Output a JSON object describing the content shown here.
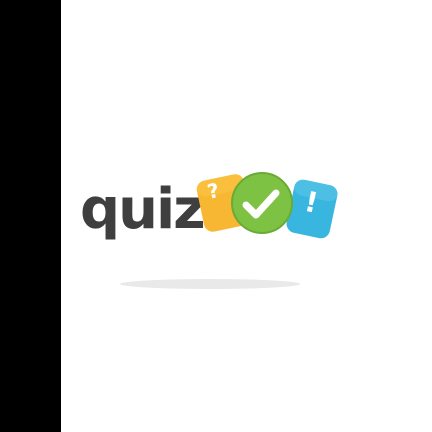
{
  "logo": {
    "word": "quiz",
    "badges": [
      {
        "symbol": "?",
        "shape": "rounded-square",
        "color": "#f7b733"
      },
      {
        "symbol": "✓",
        "shape": "circle",
        "color": "#7dc242"
      },
      {
        "symbol": "!",
        "shape": "rounded-square",
        "color": "#39b6e0"
      }
    ],
    "text_color": "#3f3f3f",
    "shadow_color": "#e6e6e6"
  },
  "side_panel": {
    "color": "#000000"
  }
}
